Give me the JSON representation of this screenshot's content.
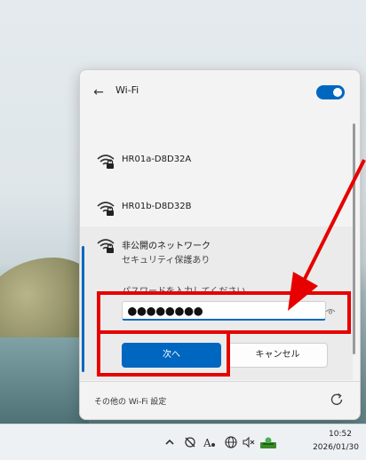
{
  "panel": {
    "title": "Wi-Fi",
    "wifi_enabled": true
  },
  "networks": [
    {
      "name": "HR01a-D8D32A",
      "secured": true
    },
    {
      "name": "HR01b-D8D32B",
      "secured": true
    }
  ],
  "hidden_network": {
    "name": "非公開のネットワーク",
    "status": "セキュリティ保護あり",
    "password_label": "パスワードを入力してください",
    "password_value": "●●●●●●●●",
    "next_label": "次へ",
    "cancel_label": "キャンセル"
  },
  "footer": {
    "more_settings_label": "その他の Wi-Fi 設定"
  },
  "taskbar": {
    "time": "10:52",
    "date": "2026/01/30"
  },
  "colors": {
    "accent": "#0067c0",
    "annotation": "#e60000"
  }
}
